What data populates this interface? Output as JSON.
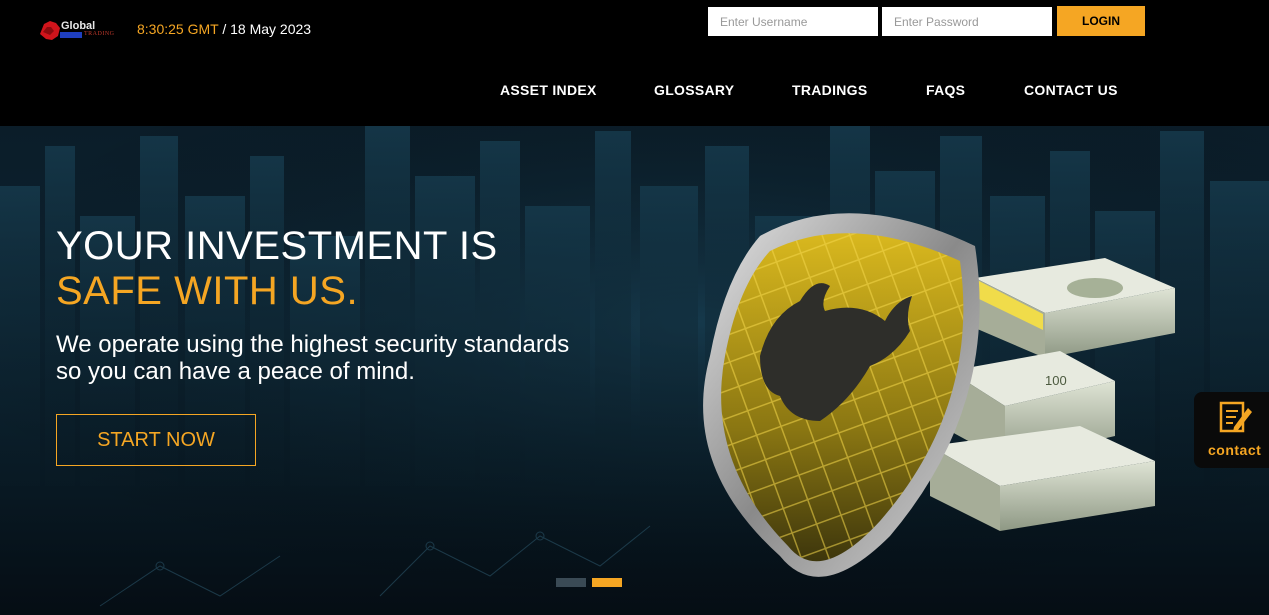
{
  "header": {
    "logo": {
      "word1": "Global",
      "word2": "TRADING"
    },
    "clock": {
      "time": "8:30:25 GMT",
      "separator": " / ",
      "date": "18 May 2023"
    },
    "login": {
      "username_placeholder": "Enter Username",
      "password_placeholder": "Enter Password",
      "button_label": "LOGIN"
    },
    "nav": [
      {
        "label": "ASSET INDEX"
      },
      {
        "label": "GLOSSARY"
      },
      {
        "label": "TRADINGS"
      },
      {
        "label": "FAQS"
      },
      {
        "label": "CONTACT US"
      }
    ]
  },
  "hero": {
    "headline_line1": "YOUR INVESTMENT IS",
    "headline_line2": "SAFE WITH US.",
    "subtext_line1": "We operate using the highest security standards",
    "subtext_line2": "so you can have a peace of mind.",
    "cta_label": "START NOW",
    "slides": {
      "count": 2,
      "active": 2
    },
    "illustration_icons": [
      "shield-icon",
      "bull-icon",
      "money-stack-icon"
    ],
    "banknote_denomination": "100"
  },
  "contact_tab": {
    "label": "contact",
    "icon": "note-pencil-icon"
  },
  "colors": {
    "accent": "#f5a623",
    "header_bg": "#000000",
    "hero_bg": "#0b1d29",
    "inactive_dot": "#3a4a55",
    "text": "#ffffff"
  }
}
